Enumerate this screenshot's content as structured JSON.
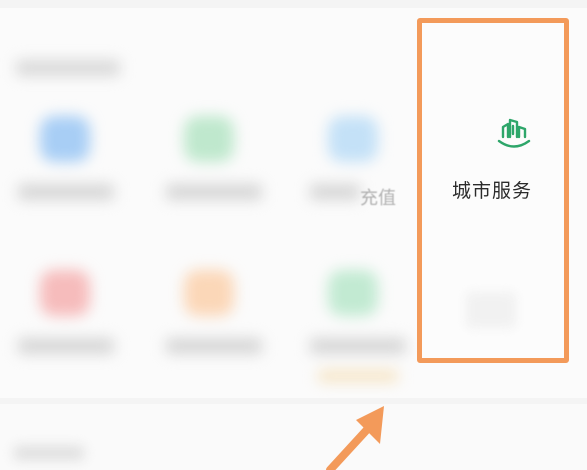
{
  "colors": {
    "highlight": "#f39a5a",
    "service_icon": "#2ea66a",
    "arrow": "#f39a5a"
  },
  "grid": {
    "partial_label": "充值"
  },
  "city_service": {
    "icon": "city-buildings-icon",
    "label": "城市服务"
  },
  "annotation": {
    "arrow_icon": "arrow-icon"
  }
}
